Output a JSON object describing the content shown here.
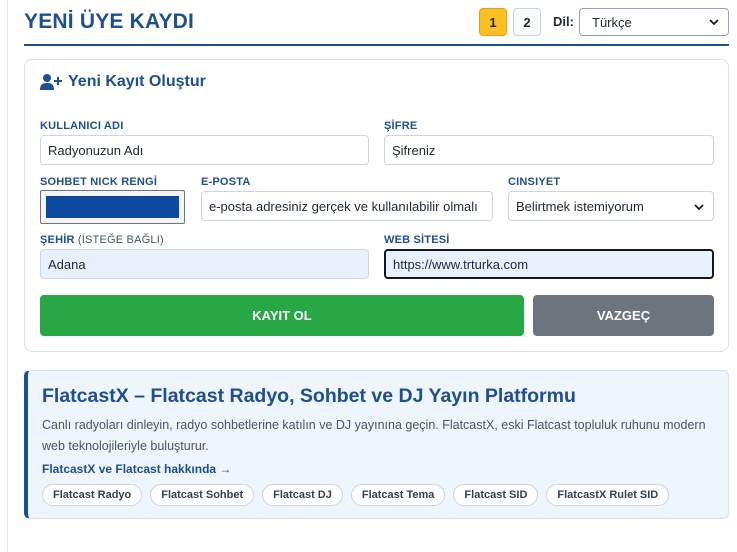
{
  "header": {
    "title": "YENİ ÜYE KAYDI",
    "pages": [
      "1",
      "2"
    ],
    "lang_label": "Dil:",
    "lang_value": "Türkçe"
  },
  "form": {
    "heading": "Yeni Kayıt Oluştur",
    "username": {
      "label": "KULLANICI ADI",
      "placeholder": "Radyonuzun Adı"
    },
    "password": {
      "label": "ŞİFRE",
      "placeholder": "Şifreniz"
    },
    "nick_color": {
      "label": "SOHBET NICK RENGİ",
      "value": "#0b4a9e"
    },
    "email": {
      "label": "E-POSTA",
      "placeholder": "e-posta adresiniz gerçek ve kullanılabilir olmalı"
    },
    "gender": {
      "label": "CINSIYET",
      "value": "Belirtmek istemiyorum"
    },
    "city": {
      "label": "ŞEHİR",
      "optional": "(İSTEĞE BAĞLI)",
      "value": "Adana"
    },
    "website": {
      "label": "WEB SİTESİ",
      "value": "https://www.trturka.com"
    },
    "submit_label": "KAYIT OL",
    "cancel_label": "VAZGEÇ"
  },
  "info": {
    "title": "FlatcastX – Flatcast Radyo, Sohbet ve DJ Yayın Platformu",
    "description": "Canlı radyoları dinleyin, radyo sohbetlerine katılın ve DJ yayınına geçin. FlatcastX, eski Flatcast topluluk ruhunu modern web teknolojileriyle buluşturur.",
    "link": "FlatcastX ve Flatcast hakkında →",
    "tags": [
      "Flatcast Radyo",
      "Flatcast Sohbet",
      "Flatcast DJ",
      "Flatcast Tema",
      "Flatcast SID",
      "FlatcastX Rulet SID"
    ]
  },
  "colors": {
    "accent": "#1e4f8f",
    "active_page": "#fbbf24",
    "submit": "#28a745",
    "cancel": "#6c757d"
  },
  "icons": {
    "heading": "user-plus-icon",
    "select": "chevron-down-icon"
  }
}
